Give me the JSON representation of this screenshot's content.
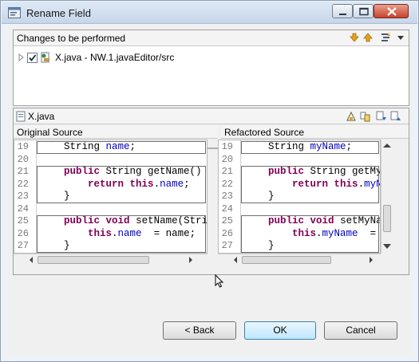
{
  "window": {
    "title": "Rename Field"
  },
  "changes": {
    "header": "Changes to be performed",
    "item": {
      "label": "X.java - NW.1.javaEditor/src",
      "checked": true
    }
  },
  "compare": {
    "file_label": "X.java",
    "original": {
      "title": "Original Source",
      "lines": [
        {
          "n": "19",
          "text": "    String name;"
        },
        {
          "n": "20",
          "text": ""
        },
        {
          "n": "21",
          "text": "    public String getName() {"
        },
        {
          "n": "22",
          "text": "        return this.name;"
        },
        {
          "n": "23",
          "text": "    }"
        },
        {
          "n": "24",
          "text": ""
        },
        {
          "n": "25",
          "text": "    public void setName(String"
        },
        {
          "n": "26",
          "text": "        this.name  = name;"
        },
        {
          "n": "27",
          "text": "    }"
        }
      ]
    },
    "refactored": {
      "title": "Refactored Source",
      "lines": [
        {
          "n": "19",
          "text": "    String myName;"
        },
        {
          "n": "20",
          "text": ""
        },
        {
          "n": "21",
          "text": "    public String getMyName"
        },
        {
          "n": "22",
          "text": "        return this.myName"
        },
        {
          "n": "23",
          "text": "    }"
        },
        {
          "n": "24",
          "text": ""
        },
        {
          "n": "25",
          "text": "    public void setMyName("
        },
        {
          "n": "26",
          "text": "        this.myName  = name"
        },
        {
          "n": "27",
          "text": "    }"
        }
      ]
    }
  },
  "buttons": {
    "back": "< Back",
    "ok": "OK",
    "cancel": "Cancel"
  },
  "colors": {
    "keyword": "#7f0055",
    "field": "#0000c0",
    "accent": "#3c7fb1"
  }
}
